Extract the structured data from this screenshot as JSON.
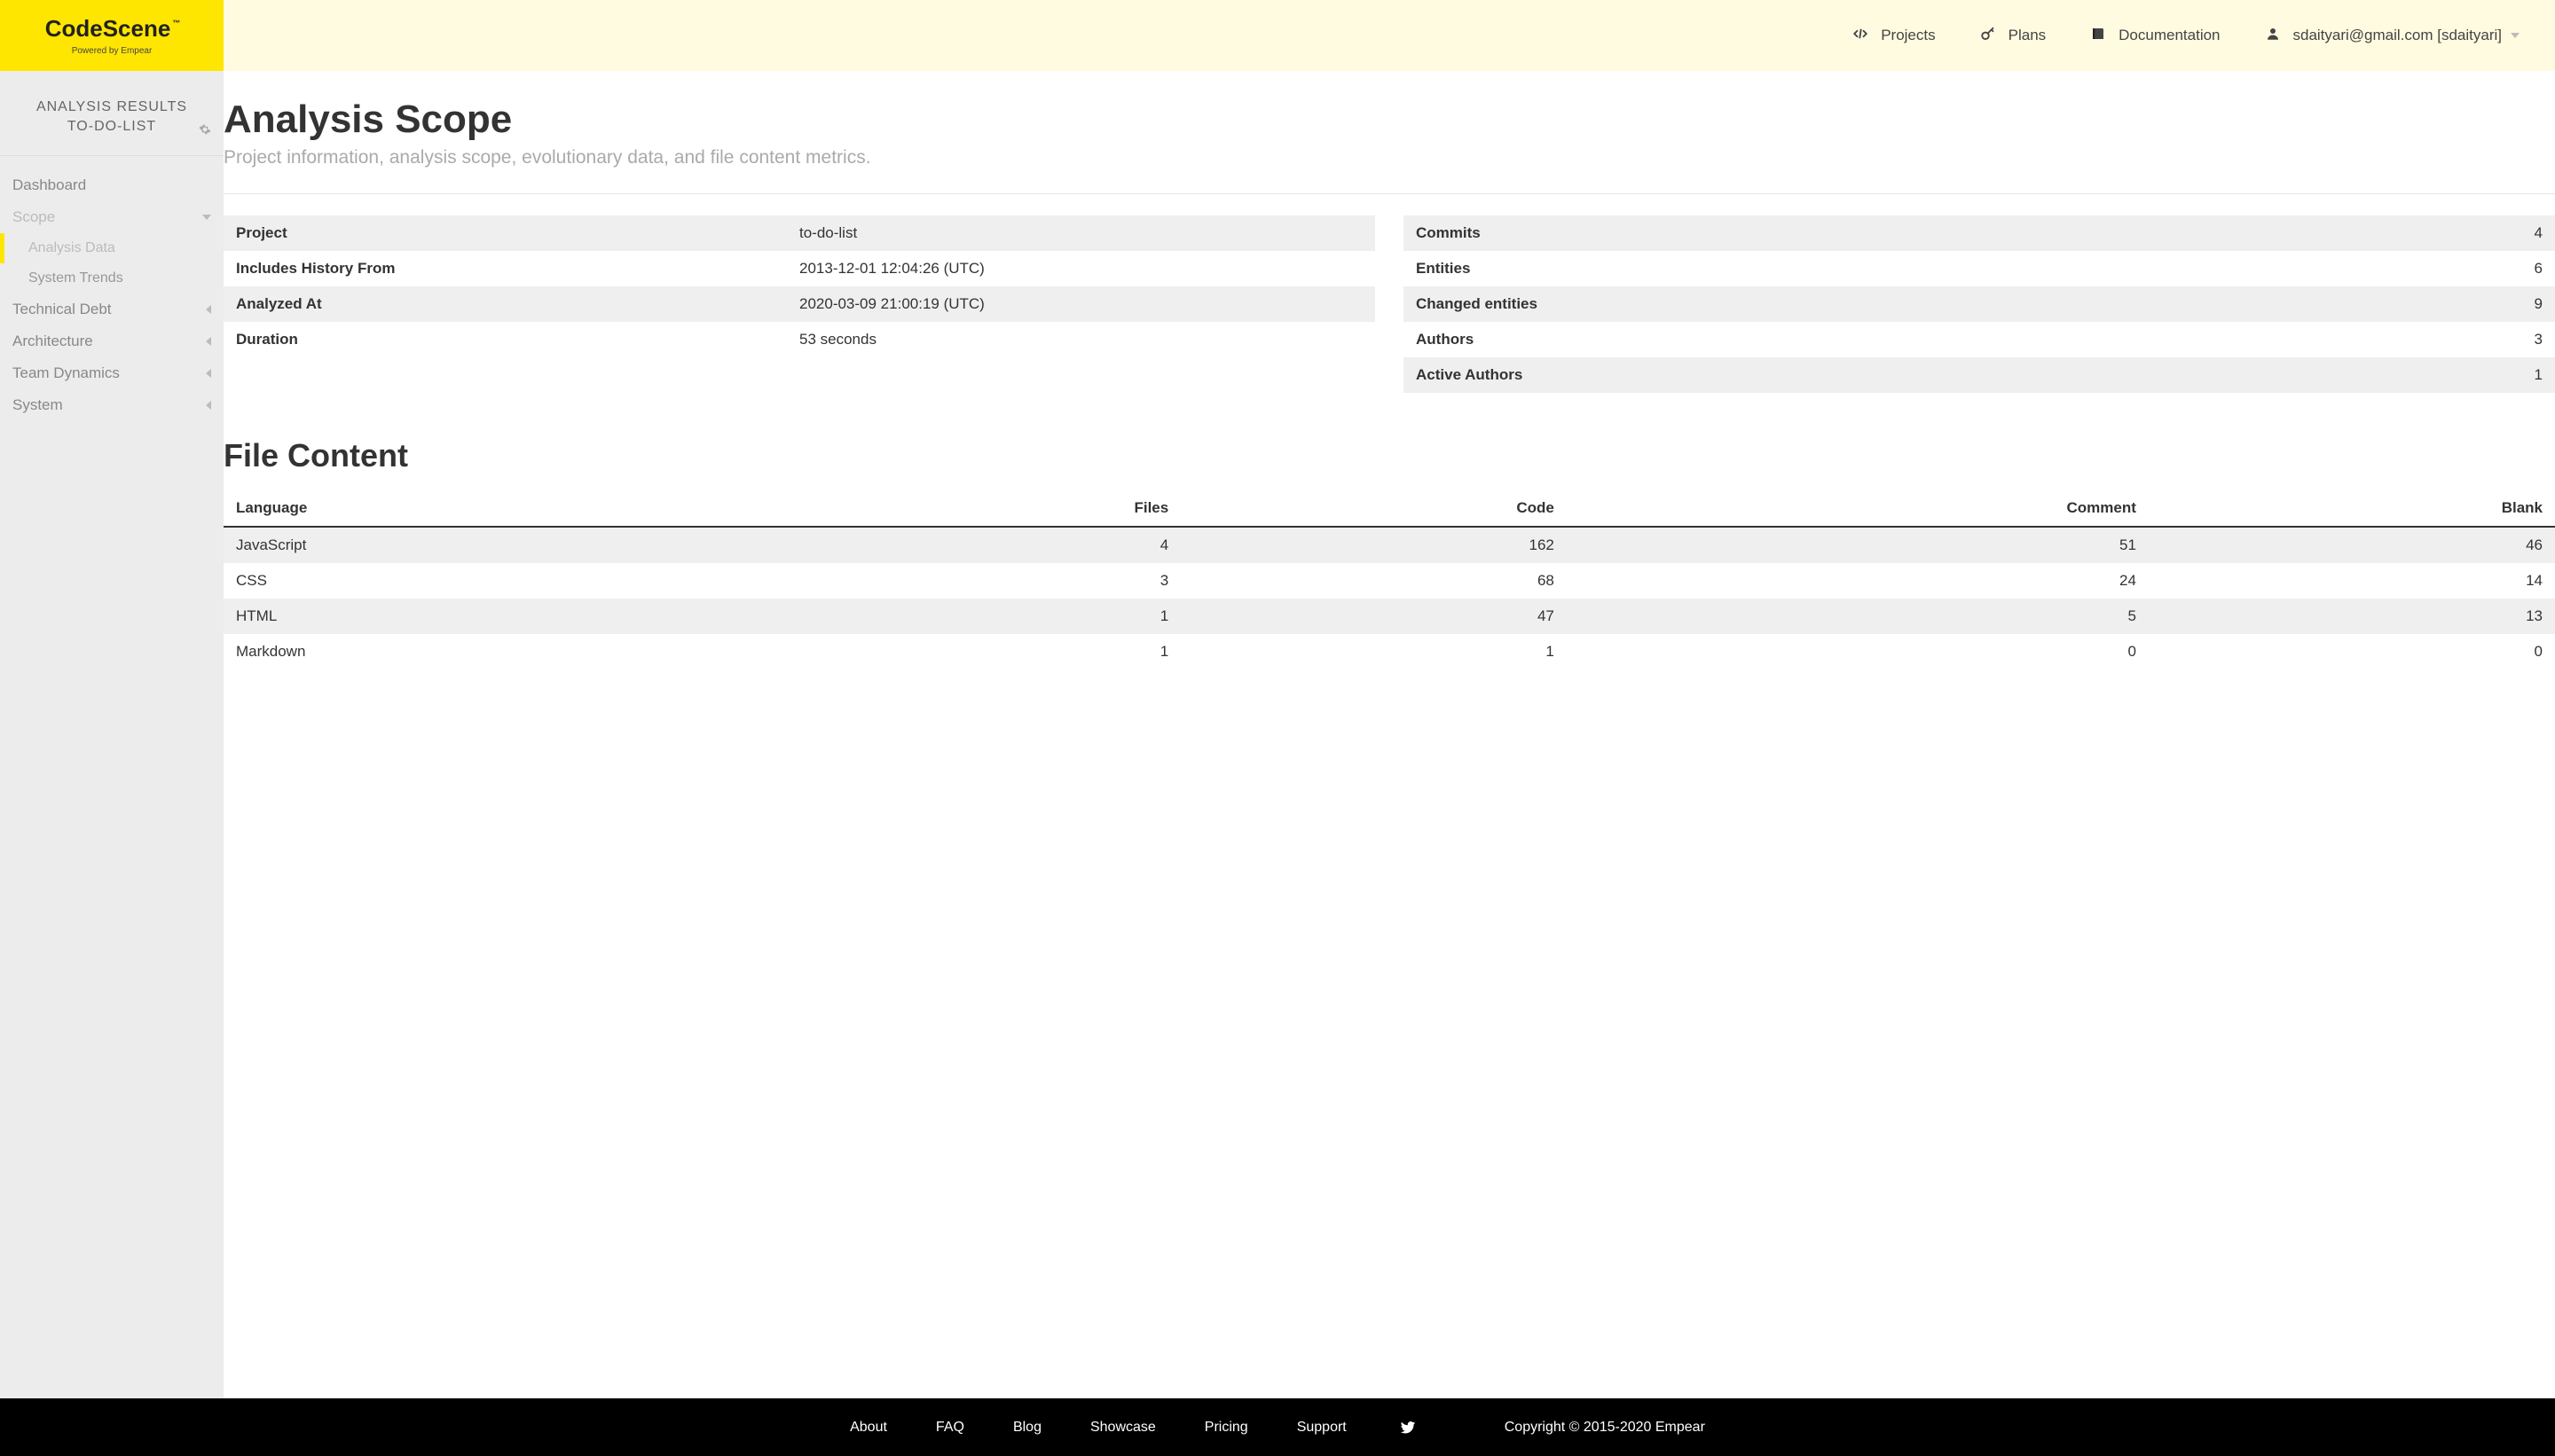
{
  "brand": {
    "name": "CodeScene",
    "tm": "™",
    "sub": "Powered by Empear"
  },
  "topnav": {
    "projects": "Projects",
    "plans": "Plans",
    "docs": "Documentation",
    "user": "sdaityari@gmail.com [sdaityari]"
  },
  "sidebar": {
    "title_line1": "ANALYSIS RESULTS",
    "title_line2": "TO-DO-LIST",
    "items": {
      "dashboard": "Dashboard",
      "scope": "Scope",
      "scope_children": [
        "Analysis Data",
        "System Trends"
      ],
      "technical_debt": "Technical Debt",
      "architecture": "Architecture",
      "team_dynamics": "Team Dynamics",
      "system": "System"
    }
  },
  "page": {
    "title": "Analysis Scope",
    "subtitle": "Project information, analysis scope, evolutionary data, and file content metrics."
  },
  "project_info": [
    {
      "label": "Project",
      "value": "to-do-list"
    },
    {
      "label": "Includes History From",
      "value": "2013-12-01 12:04:26 (UTC)"
    },
    {
      "label": "Analyzed At",
      "value": "2020-03-09 21:00:19 (UTC)"
    },
    {
      "label": "Duration",
      "value": "53 seconds"
    }
  ],
  "commit_info": [
    {
      "label": "Commits",
      "value": "4"
    },
    {
      "label": "Entities",
      "value": "6"
    },
    {
      "label": "Changed entities",
      "value": "9"
    },
    {
      "label": "Authors",
      "value": "3"
    },
    {
      "label": "Active Authors",
      "value": "1"
    }
  ],
  "file_content": {
    "title": "File Content",
    "headers": [
      "Language",
      "Files",
      "Code",
      "Comment",
      "Blank"
    ],
    "rows": [
      [
        "JavaScript",
        "4",
        "162",
        "51",
        "46"
      ],
      [
        "CSS",
        "3",
        "68",
        "24",
        "14"
      ],
      [
        "HTML",
        "1",
        "47",
        "5",
        "13"
      ],
      [
        "Markdown",
        "1",
        "1",
        "0",
        "0"
      ]
    ]
  },
  "footer": {
    "links": [
      "About",
      "FAQ",
      "Blog",
      "Showcase",
      "Pricing",
      "Support"
    ],
    "copy": "Copyright © 2015-2020 Empear"
  }
}
